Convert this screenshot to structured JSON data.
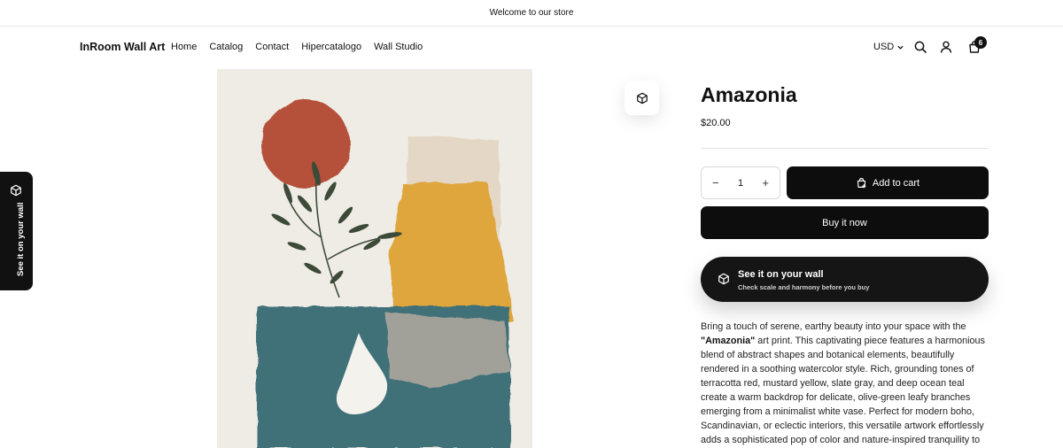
{
  "announcement": "Welcome to our store",
  "header": {
    "logo": "InRoom Wall Art",
    "nav": [
      "Home",
      "Catalog",
      "Contact",
      "Hipercatalogo",
      "Wall Studio"
    ],
    "currency": "USD",
    "cart_count": "6"
  },
  "side_tab": {
    "label": "See it on your wall"
  },
  "product": {
    "title": "Amazonia",
    "price": "$20.00",
    "quantity": "1",
    "add_to_cart": "Add to cart",
    "buy_now": "Buy it now",
    "wall_button": {
      "title": "See it on your wall",
      "subtitle": "Check scale and harmony before you buy"
    },
    "description": {
      "intro": "Bring a touch of serene, earthy beauty into your space with the",
      "name": "\"Amazonia\"",
      "body": " art print. This captivating piece features a harmonious blend of abstract shapes and botanical elements, beautifully rendered in a soothing watercolor style. Rich, grounding tones of terracotta red, mustard yellow, slate gray, and deep ocean teal create a warm backdrop for delicate, olive-green leafy branches emerging from a minimalist white vase. Perfect for modern boho, Scandinavian, or eclectic interiors, this versatile artwork effortlessly adds a sophisticated pop of color and nature-inspired tranquility to"
    }
  },
  "colors": {
    "button_black": "#0d0d0d",
    "terracotta": "#b5513a",
    "mustard": "#dea63e",
    "teal": "#3f6f78",
    "leaf": "#3d4a38"
  }
}
